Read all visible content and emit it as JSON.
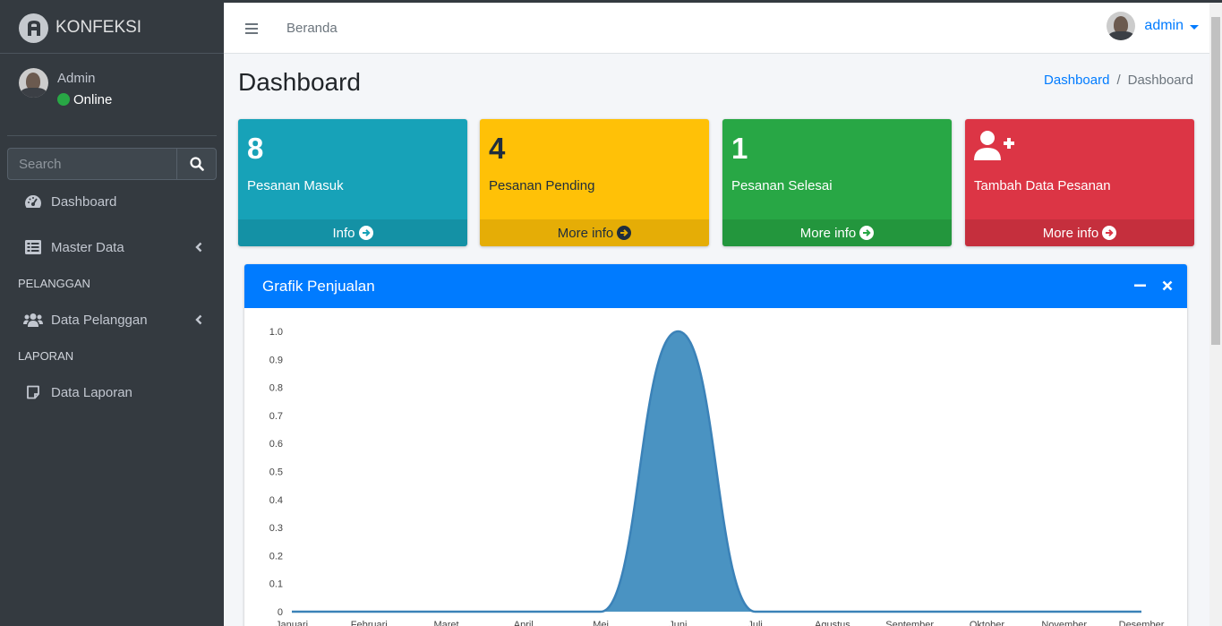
{
  "brand": {
    "name": "KONFEKSI"
  },
  "user_panel": {
    "name": "Admin",
    "status": "Online"
  },
  "search": {
    "placeholder": "Search"
  },
  "sidebar": {
    "items": [
      {
        "label": "Dashboard",
        "icon": "tachometer-icon"
      },
      {
        "label": "Master Data",
        "icon": "list-icon"
      },
      {
        "label": "Data Pelanggan",
        "icon": "users-icon"
      },
      {
        "label": "Data Laporan",
        "icon": "sticky-note-icon"
      }
    ],
    "headers": [
      "PELANGGAN",
      "LAPORAN"
    ]
  },
  "navbar": {
    "home_link": "Beranda",
    "user_label": "admin"
  },
  "page": {
    "title": "Dashboard"
  },
  "breadcrumb": [
    "Dashboard",
    "Dashboard"
  ],
  "stat_boxes": [
    {
      "value": "8",
      "label": "Pesanan Masuk",
      "footer": "Info",
      "color": "#17a2b8"
    },
    {
      "value": "4",
      "label": "Pesanan Pending",
      "footer": "More info",
      "color": "#ffc107"
    },
    {
      "value": "1",
      "label": "Pesanan Selesai",
      "footer": "More info",
      "color": "#28a745"
    },
    {
      "value": "",
      "label": "Tambah Data Pesanan",
      "footer": "More info",
      "color": "#dc3545",
      "icon": "user-plus-icon"
    }
  ],
  "card": {
    "title": "Grafik Penjualan",
    "header_color": "#007bff"
  },
  "chart_data": {
    "type": "area",
    "categories": [
      "Januari",
      "Februari",
      "Maret",
      "April",
      "Mei",
      "Juni",
      "Juli",
      "Agustus",
      "September",
      "Oktober",
      "November",
      "Desember"
    ],
    "values": [
      0,
      0,
      0,
      0,
      0,
      1,
      0,
      0,
      0,
      0,
      0,
      0
    ],
    "ylim": [
      0,
      1.0
    ],
    "yticks": [
      "0",
      "0.1",
      "0.2",
      "0.3",
      "0.4",
      "0.5",
      "0.6",
      "0.7",
      "0.8",
      "0.9",
      "1.0"
    ],
    "fill_color": "#4a93c2",
    "line_color": "#3b82b8"
  }
}
